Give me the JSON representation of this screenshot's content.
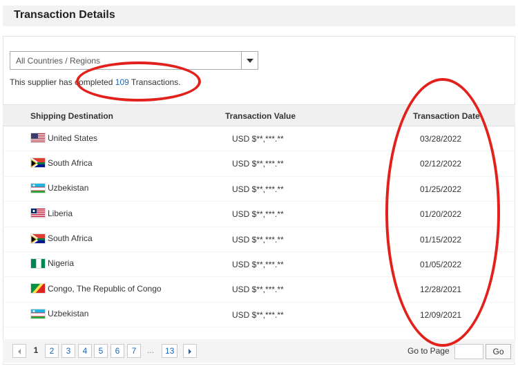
{
  "page": {
    "title": "Transaction Details"
  },
  "filter": {
    "selected": "All Countries / Regions"
  },
  "summary": {
    "prefix": "This supplier has completed",
    "count": "109",
    "suffix": "Transactions."
  },
  "table": {
    "headers": {
      "destination": "Shipping Destination",
      "value": "Transaction Value",
      "date": "Transaction Date"
    },
    "rows": [
      {
        "country": "United States",
        "flag": "us-flag-icon",
        "value": "USD $**,***.**",
        "date": "03/28/2022"
      },
      {
        "country": "South Africa",
        "flag": "za-flag-icon",
        "value": "USD $**,***.**",
        "date": "02/12/2022"
      },
      {
        "country": "Uzbekistan",
        "flag": "uz-flag-icon",
        "value": "USD $**,***.**",
        "date": "01/25/2022"
      },
      {
        "country": "Liberia",
        "flag": "lr-flag-icon",
        "value": "USD $**,***.**",
        "date": "01/20/2022"
      },
      {
        "country": "South Africa",
        "flag": "za-flag-icon",
        "value": "USD $**,***.**",
        "date": "01/15/2022"
      },
      {
        "country": "Nigeria",
        "flag": "ng-flag-icon",
        "value": "USD $**,***.**",
        "date": "01/05/2022"
      },
      {
        "country": "Congo, The Republic of Congo",
        "flag": "cg-flag-icon",
        "value": "USD $**,***.**",
        "date": "12/28/2021"
      },
      {
        "country": "Uzbekistan",
        "flag": "uz-flag-icon",
        "value": "USD $**,***.**",
        "date": "12/09/2021"
      }
    ]
  },
  "pagination": {
    "pages": [
      "1",
      "2",
      "3",
      "4",
      "5",
      "6",
      "7",
      "...",
      "13"
    ],
    "current": "1",
    "goto_label": "Go to Page",
    "goto_value": "",
    "go_button": "Go"
  },
  "colors": {
    "link": "#1a66b3",
    "annotation": "#e2211c",
    "header_bg": "#f0f0f0"
  }
}
